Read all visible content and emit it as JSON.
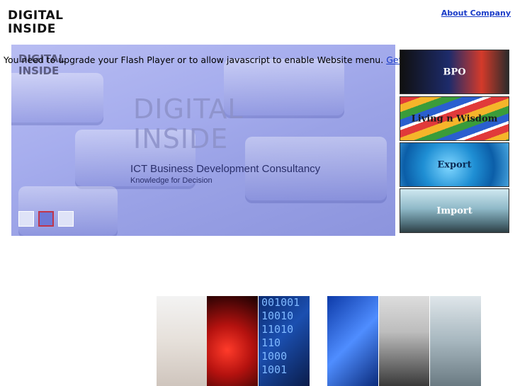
{
  "logo": {
    "line1": "DIGITAL",
    "line2": "INSIDE"
  },
  "header": {
    "about_label": "About Company"
  },
  "hero": {
    "logo_line1": "DIGITAL",
    "logo_line2": "INSIDE",
    "tagline": "ICT Business Development Consultancy",
    "subtagline": "Knowledge for Decision"
  },
  "flash_notice": {
    "message": "You need to upgrade your Flash Player or to allow javascript to enable Website menu.",
    "link_label": "Get Flash Player"
  },
  "side_menu": [
    {
      "label": "BPO"
    },
    {
      "label": "Living n Wisdom"
    },
    {
      "label": "Export"
    },
    {
      "label": "Import"
    }
  ],
  "binary_text": "001001\n10010\n11010\n110\n1000\n1001"
}
